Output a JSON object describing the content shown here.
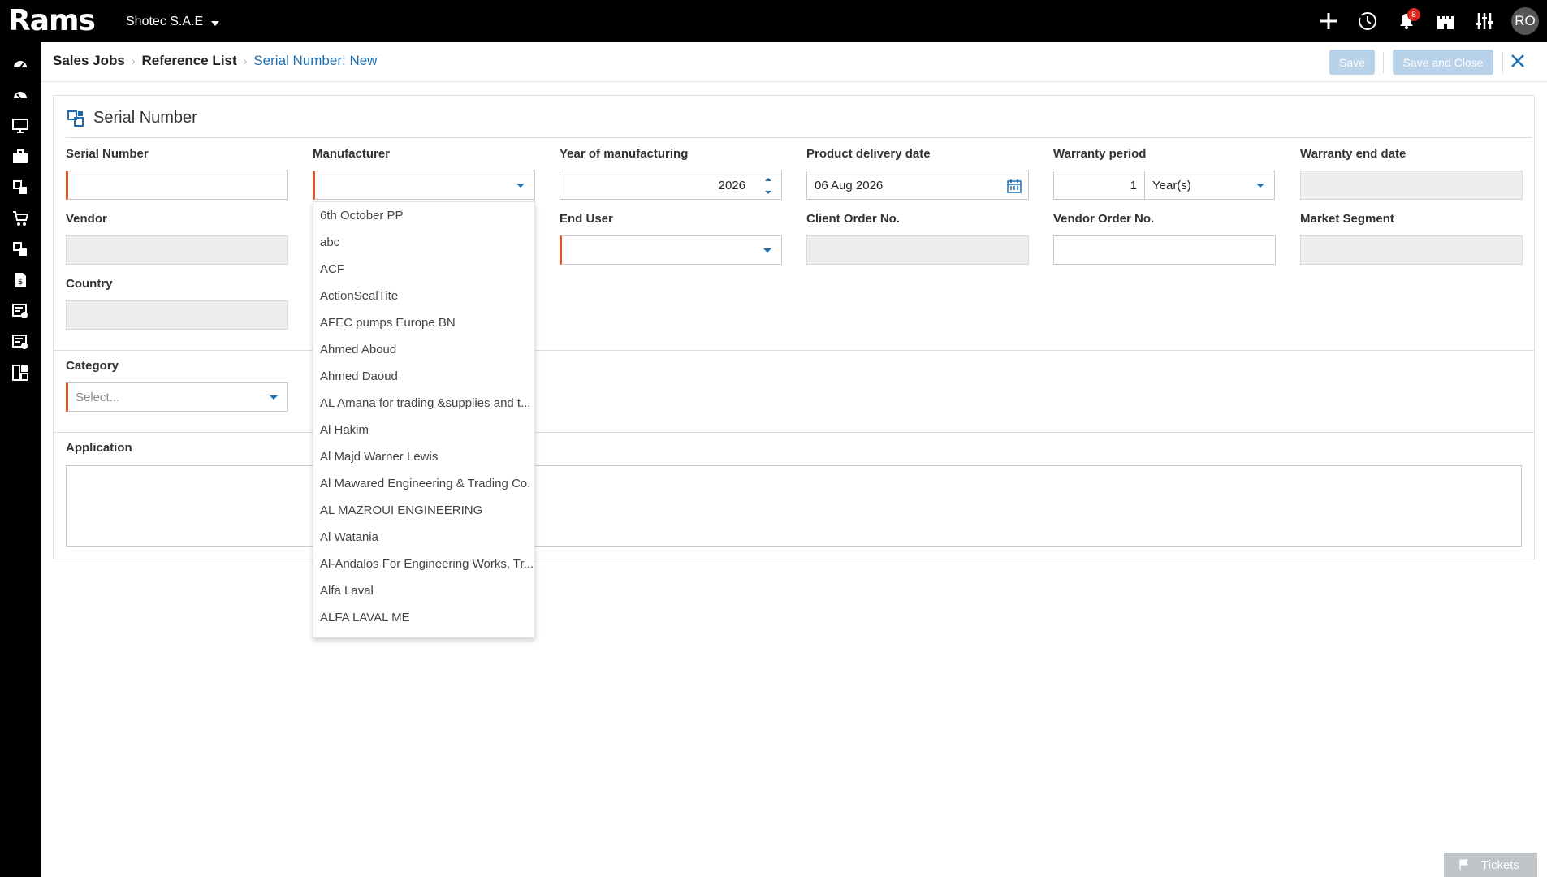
{
  "app": {
    "logo": "Rams",
    "company": "Shotec S.A.E",
    "notification_count": "8",
    "user_initials": "RO"
  },
  "breadcrumb": {
    "items": [
      "Sales Jobs",
      "Reference List"
    ],
    "current": "Serial Number: New"
  },
  "toolbar": {
    "save_label": "Save",
    "save_close_label": "Save and Close"
  },
  "form": {
    "title": "Serial Number",
    "fields": {
      "serial_number": {
        "label": "Serial Number",
        "value": ""
      },
      "manufacturer": {
        "label": "Manufacturer",
        "value": ""
      },
      "year": {
        "label": "Year of manufacturing",
        "value": "2026"
      },
      "delivery_date": {
        "label": "Product delivery date",
        "value": "06 Aug 2026"
      },
      "warranty_period": {
        "label": "Warranty period",
        "value": "1",
        "unit": "Year(s)"
      },
      "warranty_end": {
        "label": "Warranty end date",
        "value": ""
      },
      "vendor": {
        "label": "Vendor",
        "value": ""
      },
      "end_user": {
        "label": "End User",
        "value": ""
      },
      "client_order": {
        "label": "Client Order No.",
        "value": ""
      },
      "vendor_order": {
        "label": "Vendor Order No.",
        "value": ""
      },
      "market_segment": {
        "label": "Market Segment",
        "value": ""
      },
      "country": {
        "label": "Country",
        "value": ""
      },
      "category": {
        "label": "Category",
        "placeholder": "Select..."
      },
      "application": {
        "label": "Application",
        "value": ""
      }
    }
  },
  "manufacturer_options": [
    "6th October PP",
    "abc",
    "ACF",
    "ActionSealTite",
    "AFEC pumps Europe BN",
    "Ahmed Aboud",
    "Ahmed Daoud",
    "AL Amana for trading &supplies and t...",
    "Al Hakim",
    "Al Majd Warner Lewis",
    "Al Mawared Engineering & Trading Co.",
    "AL MAZROUI ENGINEERING",
    "Al Watania",
    "Al-Andalos For Engineering Works, Tr...",
    "Alfa Laval",
    "ALFA LAVAL ME"
  ],
  "tickets_label": "Tickets",
  "colors": {
    "topbar": "#000000",
    "accent": "#1f6fb0",
    "required": "#e0522b",
    "badge": "#e0241b",
    "button_disabled": "#b8d2ea"
  },
  "icons": {
    "top": [
      "plus-icon",
      "history-icon",
      "bell-icon",
      "castle-icon",
      "sliders-icon"
    ],
    "rail": [
      "dashboard-icon",
      "dashboard-icon",
      "monitor-icon",
      "briefcase-icon",
      "modules-icon",
      "cart-icon",
      "modules-icon",
      "invoice-icon",
      "checklist-icon",
      "settings-list-icon",
      "grid-icon"
    ]
  }
}
